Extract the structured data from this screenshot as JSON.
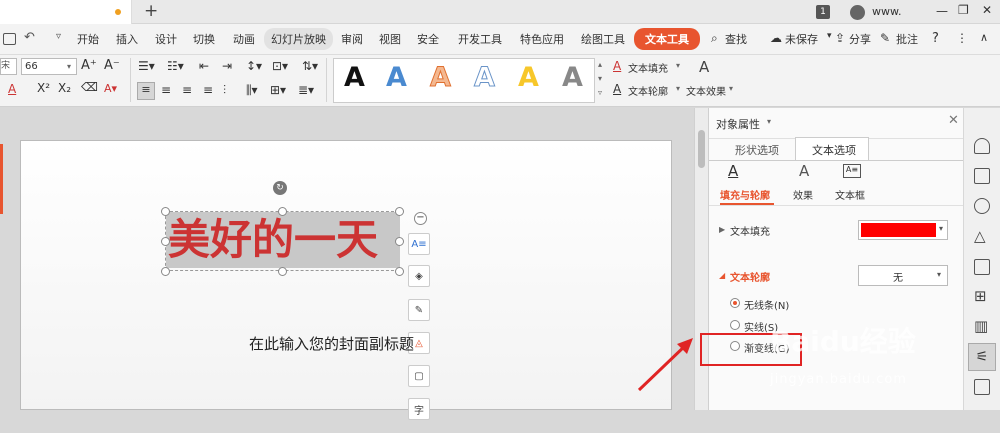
{
  "titlebar": {
    "new_tab_icon": "+",
    "page_badge": "1",
    "username": "www.",
    "window_controls": [
      "—",
      "❐",
      "✕"
    ]
  },
  "menu": {
    "items": [
      "开始",
      "插入",
      "设计",
      "切换",
      "动画",
      "幻灯片放映",
      "审阅",
      "视图",
      "安全",
      "开发工具",
      "特色应用",
      "绘图工具"
    ],
    "active_tab": "文本工具",
    "search": "查找",
    "unsaved": "未保存",
    "share": "分享",
    "comment": "批注",
    "help": "?"
  },
  "toolbar": {
    "font_prefix": "宋体",
    "font_size": "66",
    "text_fill": "文本填充",
    "text_outline": "文本轮廓",
    "text_effects": "文本效果",
    "style_letter": "A"
  },
  "slide": {
    "title": "美好的一天",
    "subtitle": "在此输入您的封面副标题",
    "title_color": "#cc3333"
  },
  "float_tools": {
    "text_tool": "A≡",
    "bottom_tool": "字"
  },
  "panel": {
    "header": "对象属性",
    "tabs": [
      "形状选项",
      "文本选项"
    ],
    "active_tab": "文本选项",
    "subtabs": [
      "填充与轮廓",
      "效果",
      "文本框"
    ],
    "active_subtab": "填充与轮廓",
    "fill_label": "文本填充",
    "fill_color": "#ff0000",
    "outline_label": "文本轮廓",
    "outline_value": "无",
    "options": [
      "无线条(N)",
      "实线(S)",
      "渐变线(G)"
    ],
    "selected_option": "无线条(N)"
  },
  "watermark": {
    "brand": "Baidu经验",
    "url": "jingyan.baidu.com"
  },
  "colors": {
    "accent": "#e8552f",
    "highlight_box": "#e02424",
    "panel_tab": "#e8552f"
  }
}
